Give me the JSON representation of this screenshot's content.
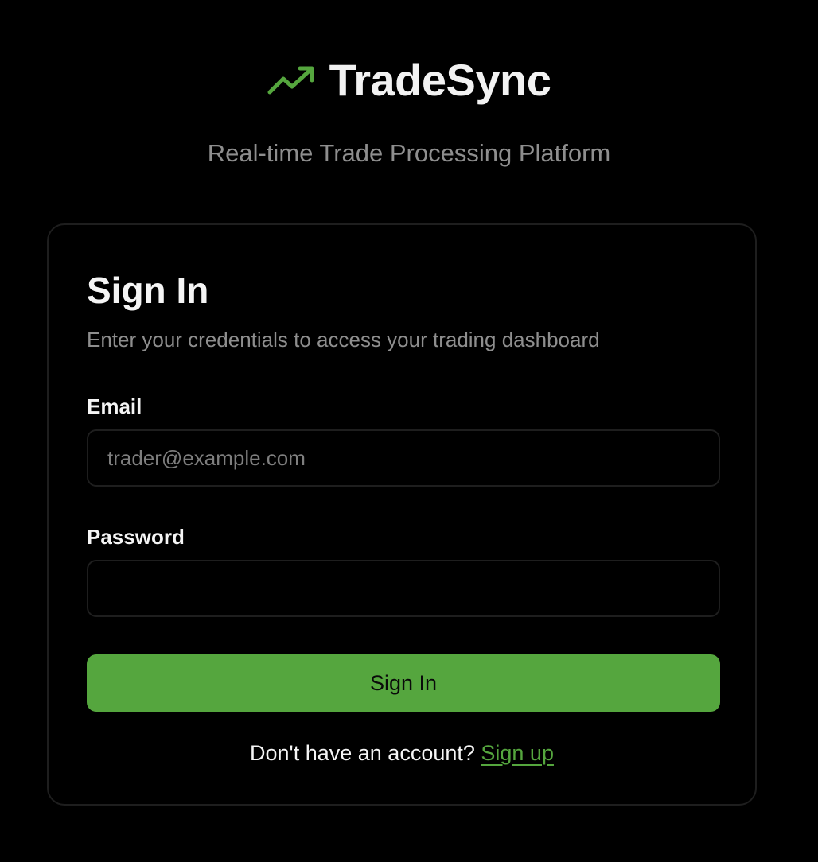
{
  "brand": {
    "name": "TradeSync",
    "icon": "trending-up-icon",
    "tagline": "Real-time Trade Processing Platform"
  },
  "colors": {
    "background": "#000000",
    "accent": "#55a63e",
    "card_border": "#1e1e1e",
    "muted_text": "#8e8e8e"
  },
  "form": {
    "title": "Sign In",
    "subtitle": "Enter your credentials to access your trading dashboard",
    "email": {
      "label": "Email",
      "placeholder": "trader@example.com",
      "value": ""
    },
    "password": {
      "label": "Password",
      "placeholder": "",
      "value": ""
    },
    "submit_label": "Sign In",
    "signup_prompt": "Don't have an account?",
    "signup_link": "Sign up"
  }
}
